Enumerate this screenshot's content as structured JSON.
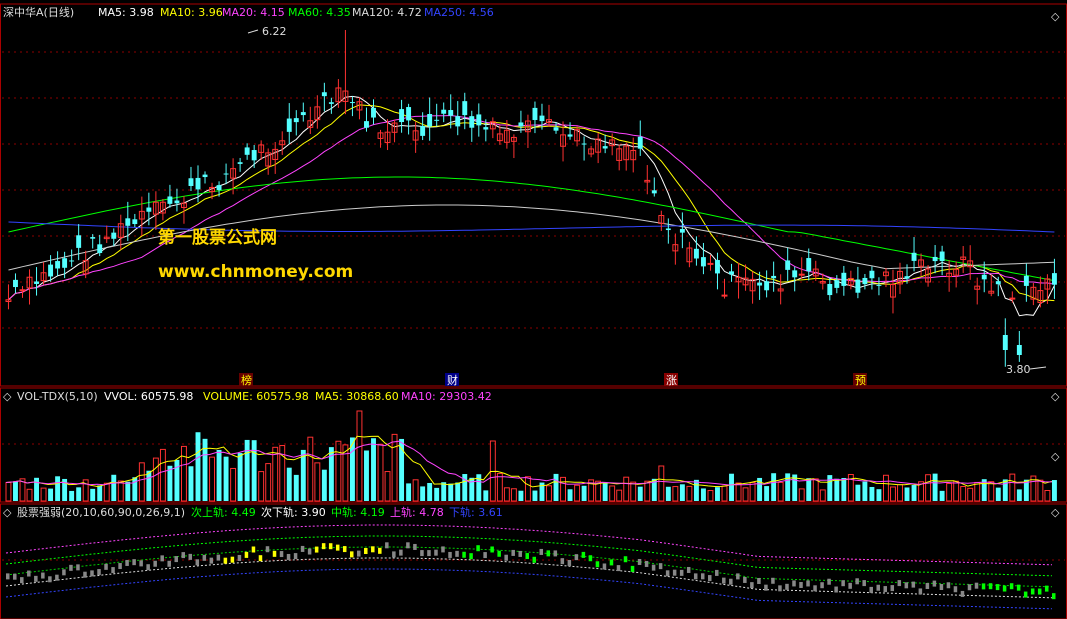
{
  "chart_data": [
    {
      "type": "candlestick",
      "title": "深中华A(日线)",
      "indicators": [
        {
          "label": "MA5: 3.98",
          "color": "#ffffff"
        },
        {
          "label": "MA10: 3.96",
          "color": "#ffff00"
        },
        {
          "label": "MA20: 4.15",
          "color": "#ff44ff"
        },
        {
          "label": "MA60: 4.35",
          "color": "#00ff00"
        },
        {
          "label": "MA120: 4.72",
          "color": "#dddddd"
        },
        {
          "label": "MA250: 4.56",
          "color": "#3344ff"
        }
      ],
      "high_label": "6.22",
      "low_label": "3.80",
      "watermark": {
        "line1": "第一股票公式网",
        "line2": "www.chnmoney.com"
      },
      "markers": [
        {
          "text": "榜",
          "color": "#ffff00",
          "bg": "#660000"
        },
        {
          "text": "财",
          "color": "#ffffff",
          "bg": "#000088"
        },
        {
          "text": "涨",
          "color": "#ffffff",
          "bg": "#880000"
        },
        {
          "text": "预",
          "color": "#ffff00",
          "bg": "#660000"
        }
      ],
      "colors": {
        "up": "#ff3232",
        "down": "#54ffff",
        "grid": "#8b0000"
      }
    },
    {
      "type": "bar",
      "title": "VOL-TDX(5,10)",
      "indicators": [
        {
          "label": "VVOL: 60575.98",
          "color": "#ffffff"
        },
        {
          "label": "VOLUME: 60575.98",
          "color": "#ffff00"
        },
        {
          "label": "MA5: 30868.60",
          "color": "#ffff00"
        },
        {
          "label": "MA10: 29303.42",
          "color": "#ff44ff"
        }
      ]
    },
    {
      "type": "band",
      "title": "股票强弱(20,10,60,90,0,26,9,1)",
      "indicators": [
        {
          "label": "次上轨: 4.49",
          "color": "#00ff00"
        },
        {
          "label": "次下轨: 3.90",
          "color": "#ffffff"
        },
        {
          "label": "中轨: 4.19",
          "color": "#00ff00"
        },
        {
          "label": "上轨: 4.78",
          "color": "#ff44ff"
        },
        {
          "label": "下轨: 3.61",
          "color": "#3344ff"
        }
      ]
    }
  ]
}
